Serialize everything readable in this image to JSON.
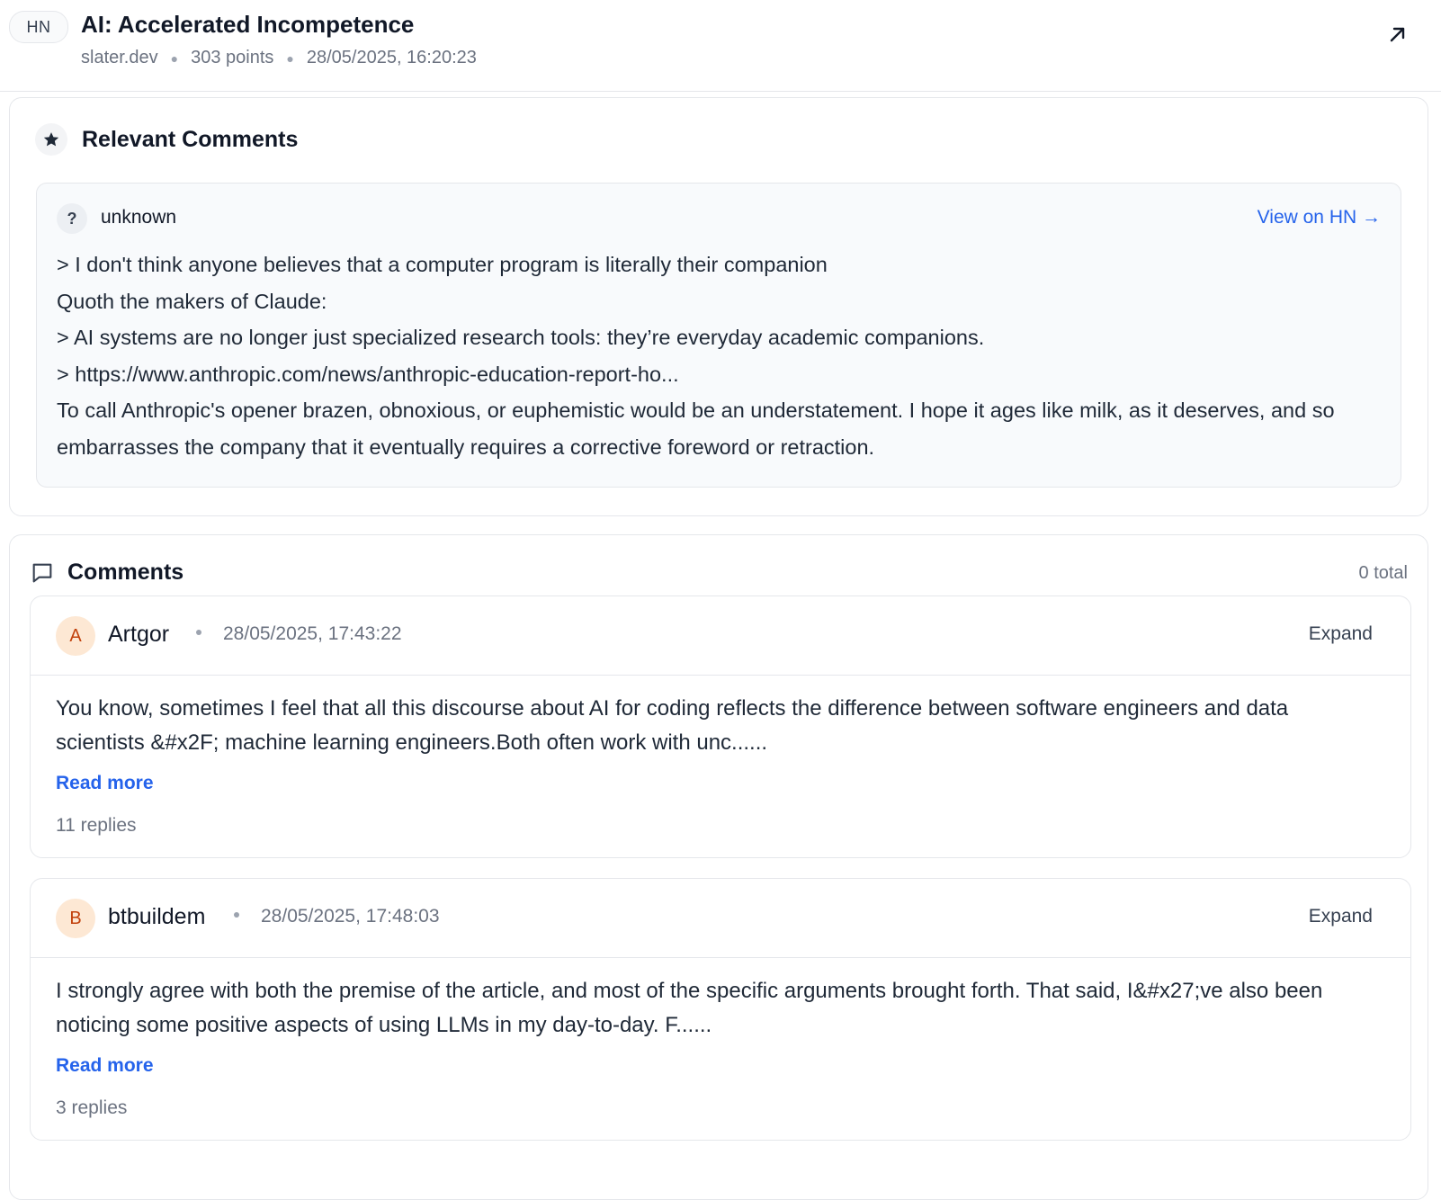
{
  "header": {
    "badge": "HN",
    "title": "AI: Accelerated Incompetence",
    "domain": "slater.dev",
    "points": "303 points",
    "timestamp": "28/05/2025, 16:20:23",
    "open_icon": "external-link-arrow-icon"
  },
  "relevant": {
    "title": "Relevant Comments",
    "icon": "star-icon",
    "comment": {
      "avatar": "?",
      "author": "unknown",
      "link_label": "View on HN →",
      "lines": [
        "> I don't think anyone believes that a computer program is literally their companion",
        "Quoth the makers of Claude:",
        "> AI systems are no longer just specialized research tools: they’re everyday academic companions.",
        "> https://www.anthropic.com/news/anthropic-education-report-ho...",
        "To call Anthropic's opener brazen, obnoxious, or euphemistic would be an understatement. I hope it ages like milk, as it deserves, and so embarrasses the company that it eventually requires a corrective foreword or retraction."
      ]
    }
  },
  "comments": {
    "title": "Comments",
    "icon": "message-square-icon",
    "total": "0 total",
    "items": [
      {
        "avatar": "A",
        "author": "Artgor",
        "time": "28/05/2025, 17:43:22",
        "expand": "Expand",
        "text": "You know, sometimes I feel that all this discourse about AI for coding reflects the difference between software engineers and data scientists &#x2F; machine learning engineers.Both often work with unc......",
        "read_more": "Read more",
        "replies": "11 replies"
      },
      {
        "avatar": "B",
        "author": "btbuildem",
        "time": "28/05/2025, 17:48:03",
        "expand": "Expand",
        "text": "I strongly agree with both the premise of the article, and most of the specific arguments brought forth. That said, I&#x27;ve also been noticing some positive aspects of using LLMs in my day-to-day. F......",
        "read_more": "Read more",
        "replies": "3 replies"
      }
    ]
  },
  "colors": {
    "accent": "#2563eb",
    "avatar_bg": "#fde8d4",
    "avatar_fg": "#c2410c",
    "border": "#e5e7eb",
    "muted": "#6b7280"
  }
}
